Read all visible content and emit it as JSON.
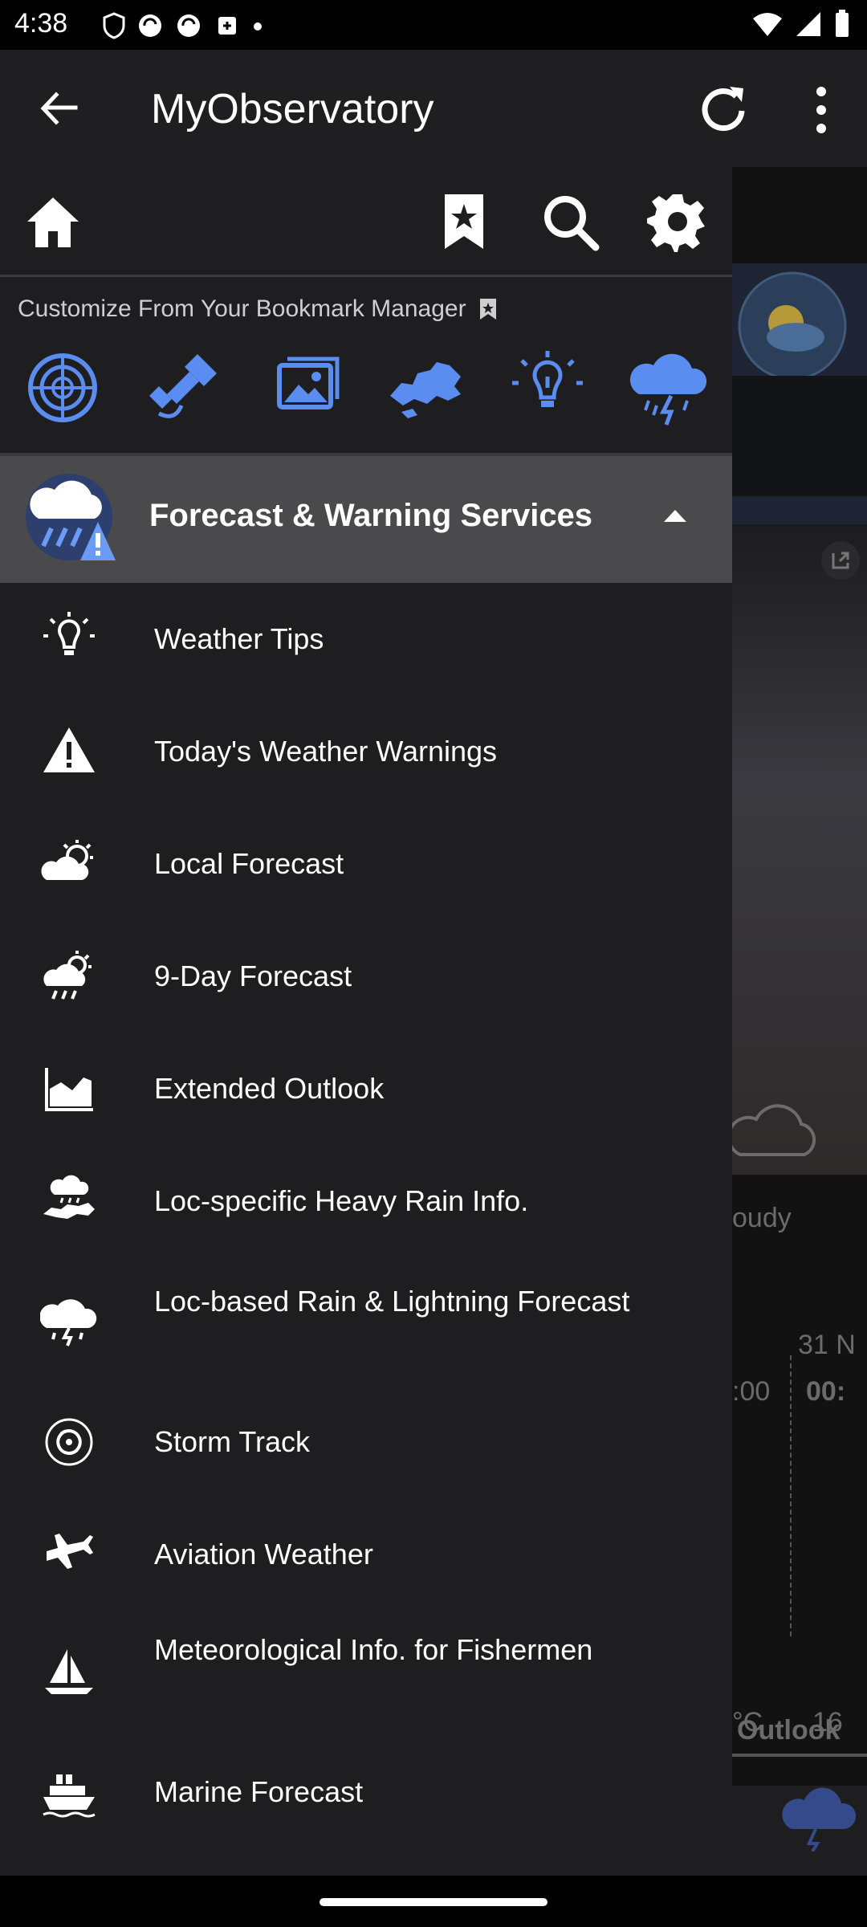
{
  "status_bar": {
    "time": "4:38"
  },
  "app_bar": {
    "title": "MyObservatory"
  },
  "drawer": {
    "bookmark_caption": "Customize From Your Bookmark Manager",
    "section": {
      "label": "Forecast & Warning Services"
    },
    "items": [
      {
        "label": "Weather Tips",
        "icon": "lightbulb-icon"
      },
      {
        "label": "Today's Weather Warnings",
        "icon": "warning-icon"
      },
      {
        "label": "Local Forecast",
        "icon": "sun-cloud-icon"
      },
      {
        "label": "9-Day Forecast",
        "icon": "sun-rain-icon"
      },
      {
        "label": "Extended Outlook",
        "icon": "chart-icon"
      },
      {
        "label": "Loc-specific Heavy Rain Info.",
        "icon": "rain-map-icon"
      },
      {
        "label": "Loc-based Rain & Lightning Forecast",
        "icon": "rain-lightning-icon"
      },
      {
        "label": "Storm Track",
        "icon": "storm-icon"
      },
      {
        "label": "Aviation Weather",
        "icon": "plane-icon"
      },
      {
        "label": "Meteorological Info. for Fishermen",
        "icon": "boat-icon"
      },
      {
        "label": "Marine Forecast",
        "icon": "ship-icon"
      }
    ]
  },
  "background": {
    "fragments": [
      "oudy",
      "31 N",
      ":00",
      "00:",
      "°C",
      "16",
      "Outlook"
    ]
  },
  "colors": {
    "accent": "#5b8cf0",
    "drawer_bg": "#1e1e20",
    "section_bg": "#4a4a4c"
  }
}
